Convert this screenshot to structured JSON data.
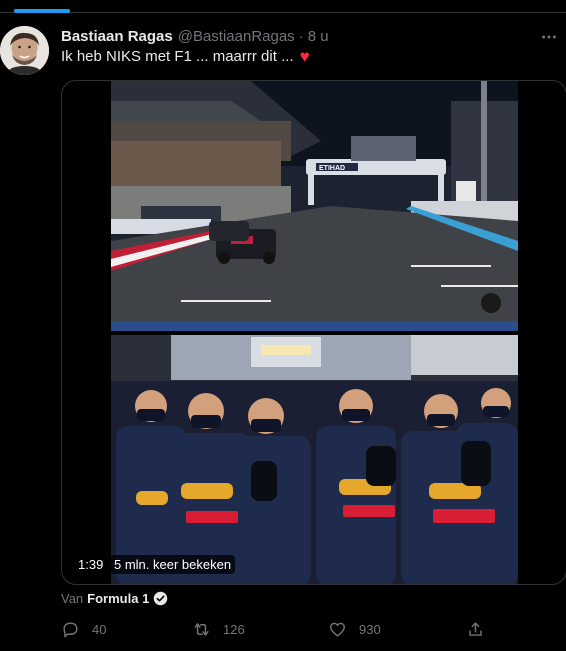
{
  "tweet": {
    "author_name": "Bastiaan Ragas",
    "author_handle": "@BastiaanRagas",
    "separator": "·",
    "time": "8 u",
    "text": "Ik heb NIKS met F1 ... maarrr dit ...",
    "more_icon": "more-icon"
  },
  "media": {
    "type": "video",
    "duration": "1:39",
    "views": "5 mln. keer bekeken",
    "frame_signage": "ETIHAD"
  },
  "source": {
    "label": "Van",
    "account": "Formula 1",
    "verified_icon": "verified-badge-icon"
  },
  "actions": {
    "reply_count": "40",
    "retweet_count": "126",
    "like_count": "930",
    "share_icon": "share-icon"
  },
  "colors": {
    "background": "#000000",
    "accent": "#1d9bf0",
    "heart": "#ff2a3d",
    "secondary_text": "#71767b",
    "primary_text": "#e7e9ea"
  }
}
